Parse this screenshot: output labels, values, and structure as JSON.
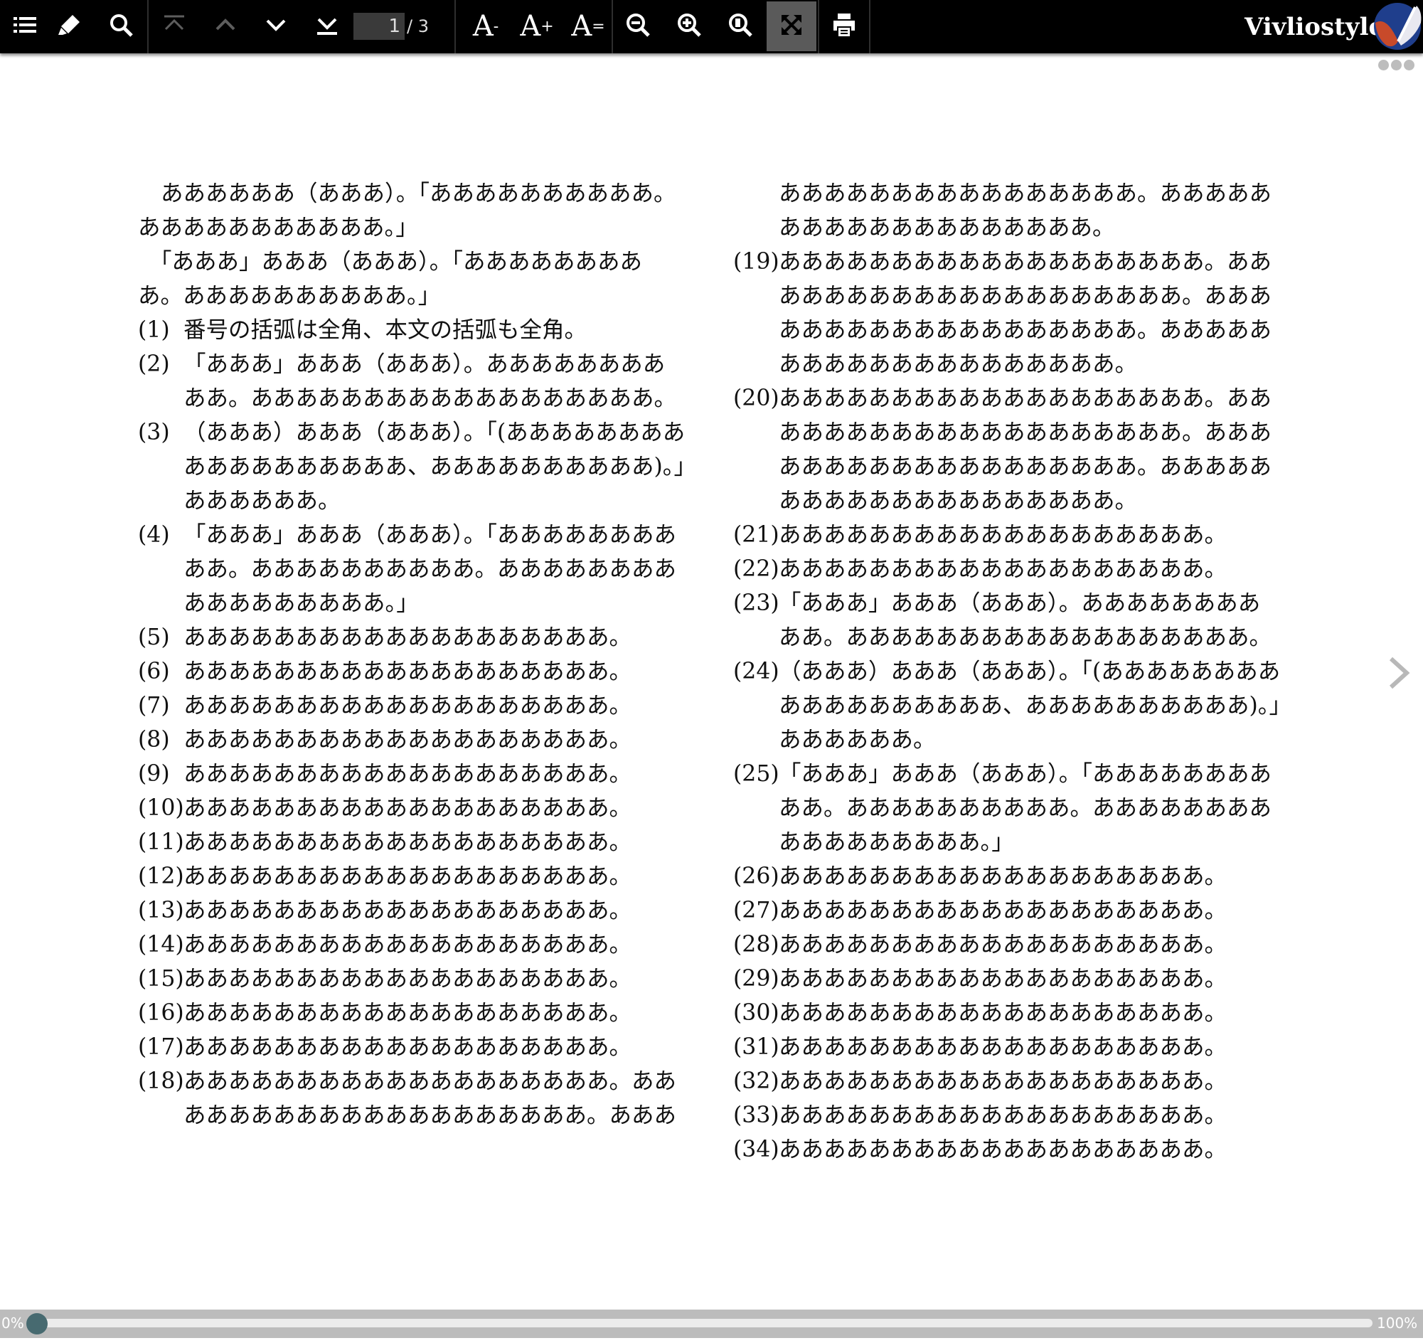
{
  "toolbar": {
    "toc_icon": "list-icon",
    "marker_icon": "marker-icon",
    "search_icon": "search-icon",
    "first_page_icon": "page-first-icon",
    "prev_page_icon": "chevron-up-icon",
    "next_page_icon": "chevron-down-icon",
    "last_page_icon": "page-last-icon",
    "page_number": "1",
    "page_total": "/ 3",
    "font_smaller_label": "A",
    "font_smaller_sup": "-",
    "font_larger_label": "A",
    "font_larger_sup": "+",
    "font_reset_label": "A",
    "font_reset_sup": "=",
    "zoom_out_icon": "zoom-out-icon",
    "zoom_in_icon": "zoom-in-icon",
    "zoom_actual_icon": "zoom-actual-icon",
    "fit_page_icon": "fit-page-icon",
    "print_icon": "print-icon",
    "brand": "Vivliostyle",
    "accent": "#5a5a5a"
  },
  "document": {
    "left": {
      "para1": "ああああああ（あああ）。「ああああああああああ。あああああああああああ。」",
      "para2": "「あああ」あああ（あああ）。「あああああああああ。ああああああああああ。」",
      "items": [
        {
          "num": "(1)",
          "text": "番号の括弧は全角、本文の括弧も全角。"
        },
        {
          "num": "(2)",
          "text": "「あああ」あああ（あああ）。ああああああああああ。ああああああああああああああああああ。"
        },
        {
          "num": "(3)",
          "text": "（あああ）あああ（あああ）。「(ああああああああああああああああああ、ああああああああああ)。」ああああああ。"
        },
        {
          "num": "(4)",
          "text": "「あああ」あああ（あああ）。「ああああああああああ。ああああああああああ。あああああああああああああああああ。」"
        },
        {
          "num": "(5)",
          "text": "あああああああああああああああああああ。"
        },
        {
          "num": "(6)",
          "text": "あああああああああああああああああああ。"
        },
        {
          "num": "(7)",
          "text": "あああああああああああああああああああ。"
        },
        {
          "num": "(8)",
          "text": "あああああああああああああああああああ。"
        },
        {
          "num": "(9)",
          "text": "あああああああああああああああああああ。"
        },
        {
          "num": "(10)",
          "text": "あああああああああああああああああああ。"
        },
        {
          "num": "(11)",
          "text": "あああああああああああああああああああ。"
        },
        {
          "num": "(12)",
          "text": "あああああああああああああああああああ。"
        },
        {
          "num": "(13)",
          "text": "あああああああああああああああああああ。"
        },
        {
          "num": "(14)",
          "text": "あああああああああああああああああああ。"
        },
        {
          "num": "(15)",
          "text": "あああああああああああああああああああ。"
        },
        {
          "num": "(16)",
          "text": "あああああああああああああああああああ。"
        },
        {
          "num": "(17)",
          "text": "あああああああああああああああああああ。"
        },
        {
          "num": "(18)",
          "text": "あああああああああああああああああああ。ああああああああああああああああああああ。あああ"
        }
      ]
    },
    "right": {
      "cont": "ああああああああああああああああ。あああああああああああああああああああ。",
      "items": [
        {
          "num": "(19)",
          "text": "あああああああああああああああああああ。ああああああああああああああああああああ。あああああああああああああああああああ。ああああああああああああああああああああ。"
        },
        {
          "num": "(20)",
          "text": "あああああああああああああああああああ。ああああああああああああああああああああ。あああああああああああああああああああ。ああああああああああああああああああああ。"
        },
        {
          "num": "(21)",
          "text": "あああああああああああああああああああ。"
        },
        {
          "num": "(22)",
          "text": "あああああああああああああああああああ。"
        },
        {
          "num": "(23)",
          "text": "「あああ」あああ（あああ）。ああああああああああ。ああああああああああああああああああ。"
        },
        {
          "num": "(24)",
          "text": "（あああ）あああ（あああ）。「(ああああああああああああああああああ、ああああああああああ)。」ああああああ。"
        },
        {
          "num": "(25)",
          "text": "「あああ」あああ（あああ）。「ああああああああああ。ああああああああああ。あああああああああああああああああ。」"
        },
        {
          "num": "(26)",
          "text": "あああああああああああああああああああ。"
        },
        {
          "num": "(27)",
          "text": "あああああああああああああああああああ。"
        },
        {
          "num": "(28)",
          "text": "あああああああああああああああああああ。"
        },
        {
          "num": "(29)",
          "text": "あああああああああああああああああああ。"
        },
        {
          "num": "(30)",
          "text": "あああああああああああああああああああ。"
        },
        {
          "num": "(31)",
          "text": "あああああああああああああああああああ。"
        },
        {
          "num": "(32)",
          "text": "あああああああああああああああああああ。"
        },
        {
          "num": "(33)",
          "text": "あああああああああああああああああああ。"
        },
        {
          "num": "(34)",
          "text": "あああああああああああああああああああ。"
        }
      ]
    }
  },
  "navigation": {
    "next_icon": "chevron-right-icon"
  },
  "more_menu": {
    "icon": "more-dots-icon"
  },
  "progress": {
    "start_label": "0%",
    "end_label": "100%",
    "value": 0
  }
}
